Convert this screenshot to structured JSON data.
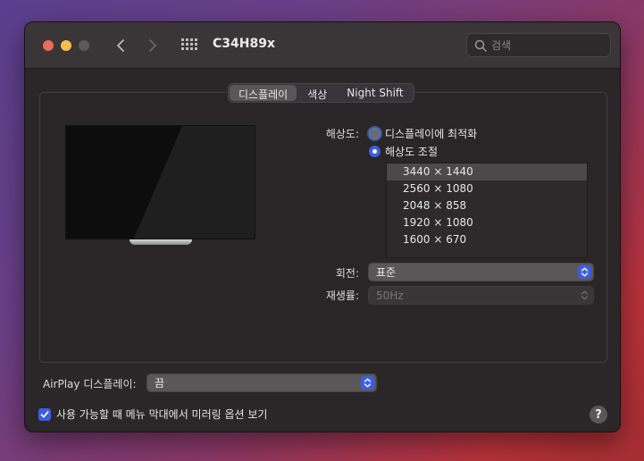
{
  "window": {
    "title": "C34H89x",
    "search_placeholder": "검색"
  },
  "tabs": [
    {
      "label": "디스플레이",
      "active": true
    },
    {
      "label": "색상",
      "active": false
    },
    {
      "label": "Night Shift",
      "active": false
    }
  ],
  "resolution": {
    "label": "해상도:",
    "option_default": "디스플레이에 최적화",
    "option_scaled": "해상도 조절",
    "selected_option": "해상도 조절",
    "list": [
      "3440 × 1440",
      "2560 × 1080",
      "2048 × 858",
      "1920 × 1080",
      "1600 × 670"
    ],
    "selected": "3440 × 1440"
  },
  "rotation": {
    "label": "회전:",
    "value": "표준"
  },
  "refresh": {
    "label": "재생률:",
    "value": "50Hz"
  },
  "airplay": {
    "label": "AirPlay 디스플레이:",
    "value": "끔"
  },
  "mirroring": {
    "label": "사용 가능할 때 메뉴 막대에서 미러링 옵션 보기",
    "checked": true
  },
  "help": {
    "label": "?"
  },
  "colors": {
    "accent": "#3c5ee3",
    "window_bg": "#2b2628",
    "titlebar_bg": "#3a3537"
  },
  "icons": [
    "close-traffic-light",
    "minimize-traffic-light",
    "zoom-traffic-light",
    "chevron-left-icon",
    "chevron-right-icon",
    "grid-icon",
    "search-icon",
    "checkmark-icon",
    "up-down-chevron-icon",
    "help-icon"
  ]
}
